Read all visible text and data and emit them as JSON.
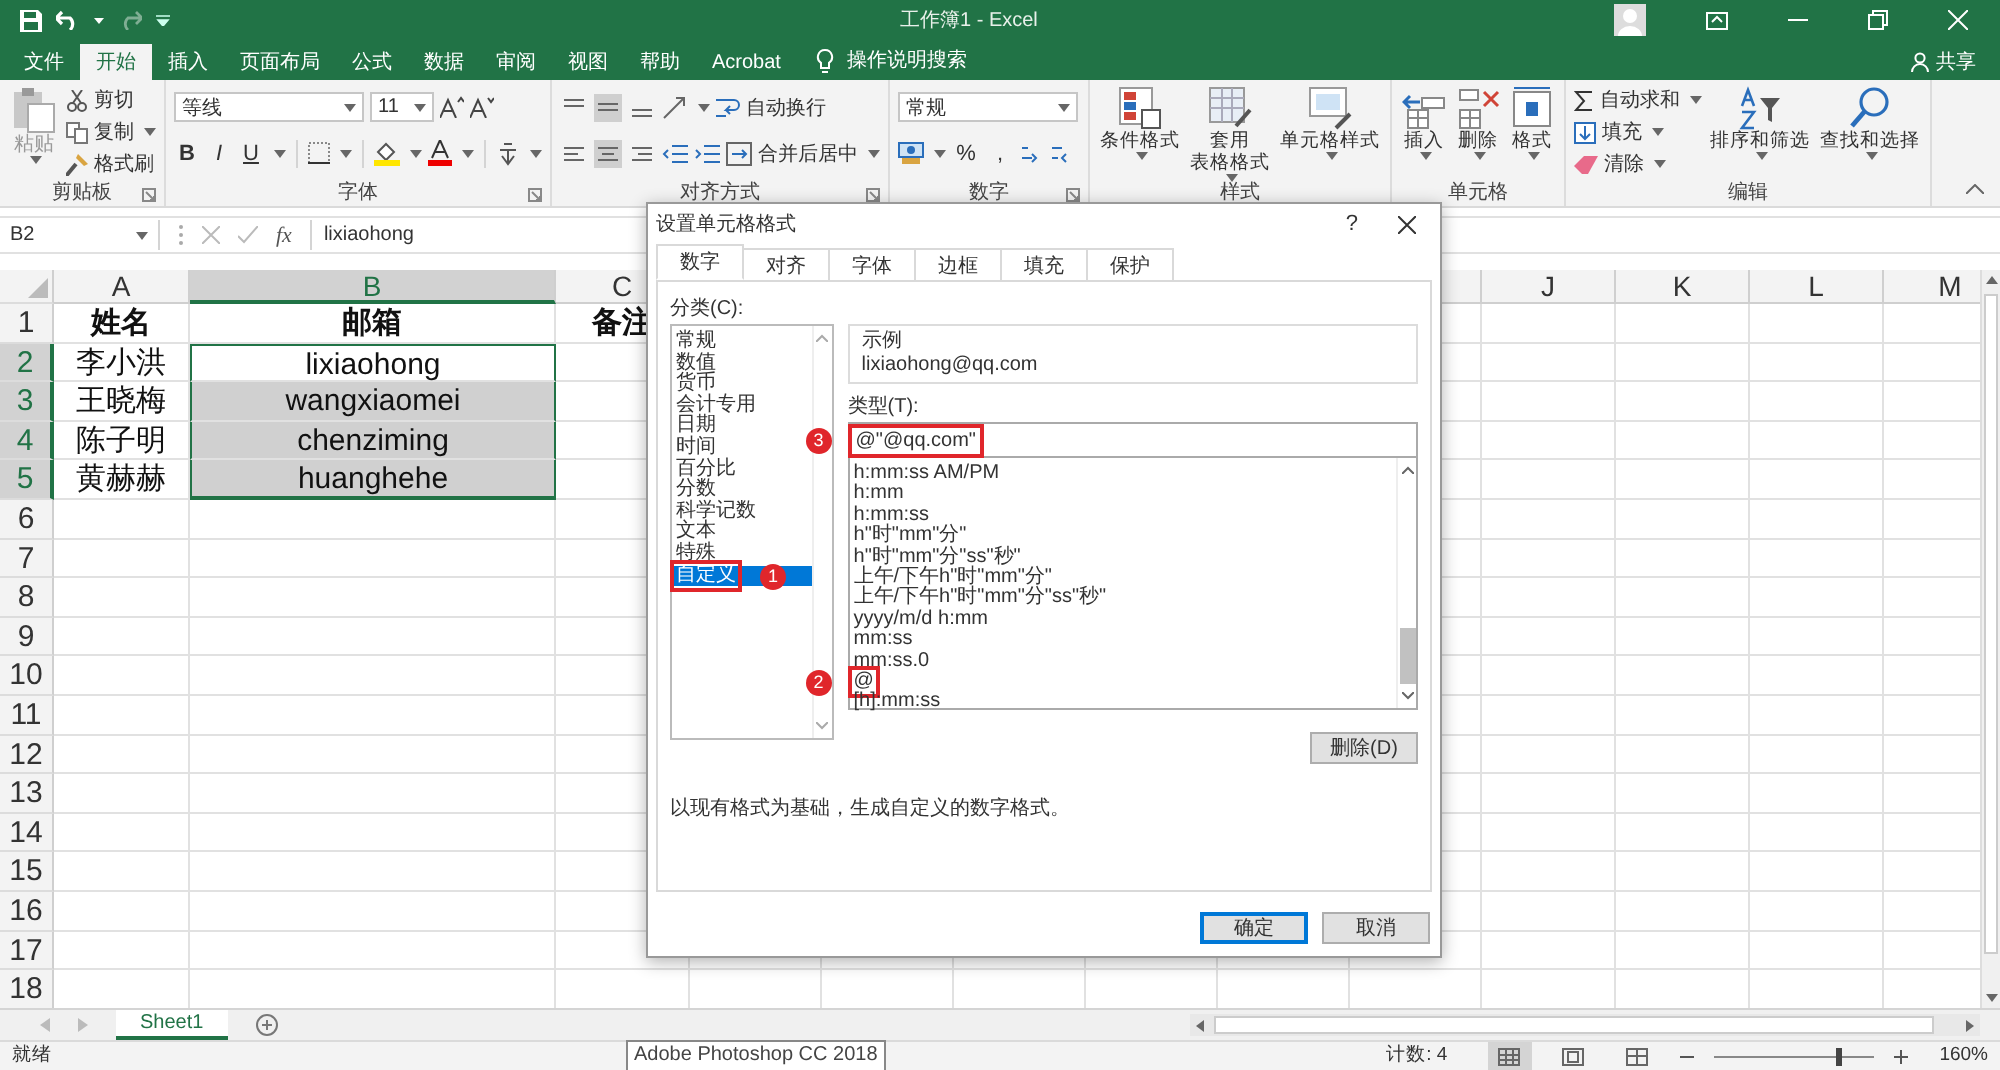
{
  "window": {
    "title": "工作簿1 - Excel"
  },
  "menu_tabs": [
    {
      "label": "文件",
      "selected": false
    },
    {
      "label": "开始",
      "selected": true
    },
    {
      "label": "插入",
      "selected": false
    },
    {
      "label": "页面布局",
      "selected": false
    },
    {
      "label": "公式",
      "selected": false
    },
    {
      "label": "数据",
      "selected": false
    },
    {
      "label": "审阅",
      "selected": false
    },
    {
      "label": "视图",
      "selected": false
    },
    {
      "label": "帮助",
      "selected": false
    },
    {
      "label": "Acrobat",
      "selected": false
    }
  ],
  "tell_me": "操作说明搜索",
  "share": "共享",
  "ribbon": {
    "groups": [
      {
        "kind": "clipboard",
        "label": "剪贴板",
        "launcher": true,
        "paste": {
          "label": "粘贴",
          "disabled": true
        },
        "items": [
          "剪切",
          "复制",
          "格式刷"
        ]
      },
      {
        "kind": "font",
        "label": "字体",
        "launcher": true,
        "font": "等线",
        "size": "11",
        "styles": [
          "B",
          "I",
          "U"
        ]
      },
      {
        "kind": "alignment",
        "label": "对齐方式",
        "launcher": true,
        "wrap": "自动换行",
        "merge": "合并后居中"
      },
      {
        "kind": "number",
        "label": "数字",
        "launcher": true,
        "format": "常规",
        "symbols": [
          "%",
          ","
        ]
      },
      {
        "kind": "styles",
        "label": "样式",
        "launcher": false,
        "items": [
          [
            "条件格式"
          ],
          [
            "套用",
            "表格格式"
          ],
          [
            "单元格样式"
          ]
        ]
      },
      {
        "kind": "cells",
        "label": "单元格",
        "launcher": false,
        "items": [
          "插入",
          "删除",
          "格式"
        ]
      },
      {
        "kind": "editing",
        "label": "编辑",
        "launcher": false,
        "small": [
          "自动求和",
          "填充",
          "清除"
        ],
        "large": [
          "排序和筛选",
          "查找和选择"
        ]
      }
    ]
  },
  "formula_bar": {
    "name_box": "B2",
    "fx": "fx",
    "value": "lixiaohong"
  },
  "sheet": {
    "columns": [
      {
        "label": "A",
        "selected": false
      },
      {
        "label": "B",
        "selected": true
      },
      {
        "label": "C",
        "selected": false
      }
    ],
    "far_columns": [
      {
        "label": "J",
        "selected": false
      },
      {
        "label": "K",
        "selected": false
      },
      {
        "label": "L",
        "selected": false
      },
      {
        "label": "M",
        "selected": false
      }
    ],
    "header_row": {
      "number": "1",
      "cells": [
        "姓名",
        "邮箱",
        "备注"
      ]
    },
    "rows": [
      {
        "number": "2",
        "selected": true,
        "cells": [
          "李小洪",
          "lixiaohong"
        ]
      },
      {
        "number": "3",
        "selected": true,
        "cells": [
          "王晓梅",
          "wangxiaomei"
        ]
      },
      {
        "number": "4",
        "selected": true,
        "cells": [
          "陈子明",
          "chenziming"
        ]
      },
      {
        "number": "5",
        "selected": true,
        "cells": [
          "黄赫赫",
          "huanghehe"
        ]
      },
      {
        "number": "6",
        "selected": false,
        "cells": []
      },
      {
        "number": "7",
        "selected": false,
        "cells": []
      },
      {
        "number": "8",
        "selected": false,
        "cells": []
      },
      {
        "number": "9",
        "selected": false,
        "cells": []
      },
      {
        "number": "10",
        "selected": false,
        "cells": []
      },
      {
        "number": "11",
        "selected": false,
        "cells": []
      },
      {
        "number": "12",
        "selected": false,
        "cells": []
      },
      {
        "number": "13",
        "selected": false,
        "cells": []
      },
      {
        "number": "14",
        "selected": false,
        "cells": []
      },
      {
        "number": "15",
        "selected": false,
        "cells": []
      },
      {
        "number": "16",
        "selected": false,
        "cells": []
      },
      {
        "number": "17",
        "selected": false,
        "cells": []
      },
      {
        "number": "18",
        "selected": false,
        "cells": []
      }
    ]
  },
  "sheet_tabs": [
    {
      "label": "Sheet1",
      "selected": true
    }
  ],
  "status": {
    "ready": "就绪",
    "count": "计数: 4",
    "zoom": "160%"
  },
  "view_modes": [
    {
      "selected": true
    },
    {
      "selected": false
    },
    {
      "selected": false
    }
  ],
  "zoom_slider": {
    "level": 0.78
  },
  "tooltip": "Adobe Photoshop CC 2018",
  "dialog": {
    "title": "设置单元格格式",
    "help": "?",
    "tabs": [
      {
        "label": "数字",
        "selected": true
      },
      {
        "label": "对齐",
        "selected": false
      },
      {
        "label": "字体",
        "selected": false
      },
      {
        "label": "边框",
        "selected": false
      },
      {
        "label": "填充",
        "selected": false
      },
      {
        "label": "保护",
        "selected": false
      }
    ],
    "category_label": "分类(C):",
    "categories": [
      {
        "label": "常规",
        "selected": false
      },
      {
        "label": "数值",
        "selected": false
      },
      {
        "label": "货币",
        "selected": false
      },
      {
        "label": "会计专用",
        "selected": false
      },
      {
        "label": "日期",
        "selected": false
      },
      {
        "label": "时间",
        "selected": false
      },
      {
        "label": "百分比",
        "selected": false
      },
      {
        "label": "分数",
        "selected": false
      },
      {
        "label": "科学记数",
        "selected": false
      },
      {
        "label": "文本",
        "selected": false
      },
      {
        "label": "特殊",
        "selected": false
      },
      {
        "label": "自定义",
        "selected": true,
        "marker": "1"
      }
    ],
    "sample_label": "示例",
    "sample": "lixiaohong@qq.com",
    "type_label": "类型(T):",
    "type_value": "@\"@qq.com\"",
    "type_marker": "3",
    "formats": [
      {
        "label": "h:mm:ss AM/PM"
      },
      {
        "label": "h:mm"
      },
      {
        "label": "h:mm:ss"
      },
      {
        "label": "h\"时\"mm\"分\""
      },
      {
        "label": "h\"时\"mm\"分\"ss\"秒\""
      },
      {
        "label": "上午/下午h\"时\"mm\"分\""
      },
      {
        "label": "上午/下午h\"时\"mm\"分\"ss\"秒\""
      },
      {
        "label": "yyyy/m/d h:mm"
      },
      {
        "label": "mm:ss"
      },
      {
        "label": "mm:ss.0"
      },
      {
        "label": "@",
        "marker": "2"
      },
      {
        "label": "[h]:mm:ss"
      }
    ],
    "delete_button": "删除(D)",
    "description": "以现有格式为基础，生成自定义的数字格式。",
    "buttons": [
      {
        "label": "确定",
        "kind": "default"
      },
      {
        "label": "取消",
        "kind": "normal"
      }
    ]
  }
}
